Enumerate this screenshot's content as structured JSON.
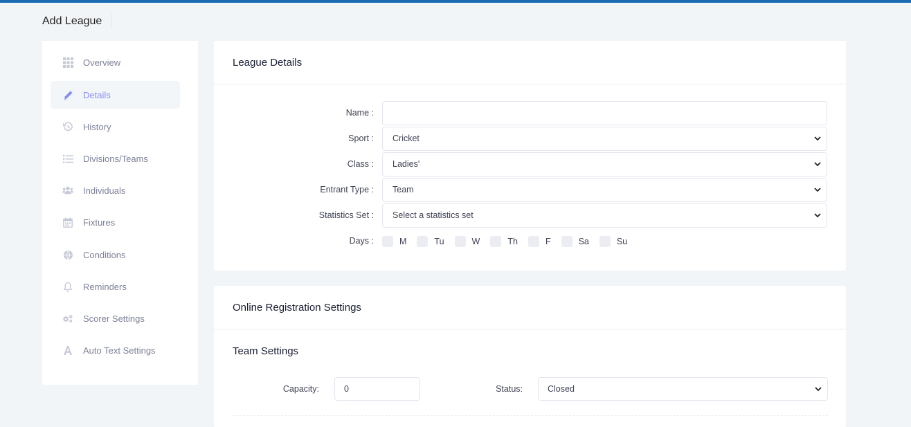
{
  "page": {
    "title": "Add League"
  },
  "sidebar": {
    "items": [
      {
        "label": "Overview",
        "icon": "grid-icon",
        "active": false
      },
      {
        "label": "Details",
        "icon": "pencil-icon",
        "active": true
      },
      {
        "label": "History",
        "icon": "history-icon",
        "active": false
      },
      {
        "label": "Divisions/Teams",
        "icon": "list-icon",
        "active": false
      },
      {
        "label": "Individuals",
        "icon": "users-icon",
        "active": false
      },
      {
        "label": "Fixtures",
        "icon": "calendar-icon",
        "active": false
      },
      {
        "label": "Conditions",
        "icon": "globe-icon",
        "active": false
      },
      {
        "label": "Reminders",
        "icon": "bell-icon",
        "active": false
      },
      {
        "label": "Scorer Settings",
        "icon": "gears-icon",
        "active": false
      },
      {
        "label": "Auto Text Settings",
        "icon": "font-icon",
        "active": false
      }
    ]
  },
  "league_details": {
    "heading": "League Details",
    "name_label": "Name :",
    "name_value": "",
    "sport_label": "Sport :",
    "sport_value": "Cricket",
    "class_label": "Class :",
    "class_value": "Ladies'",
    "entrant_label": "Entrant Type :",
    "entrant_value": "Team",
    "stats_label": "Statistics Set :",
    "stats_value": "Select a statistics set",
    "days_label": "Days :",
    "days": [
      "M",
      "Tu",
      "W",
      "Th",
      "F",
      "Sa",
      "Su"
    ]
  },
  "registration": {
    "heading": "Online Registration Settings",
    "team_heading": "Team Settings",
    "capacity_label": "Capacity:",
    "capacity_value": "0",
    "status_label": "Status:",
    "status_value": "Closed"
  },
  "colors": {
    "accent": "#1c6bb0",
    "active_nav": "#8a8ef0",
    "background": "#f2f5f8"
  }
}
